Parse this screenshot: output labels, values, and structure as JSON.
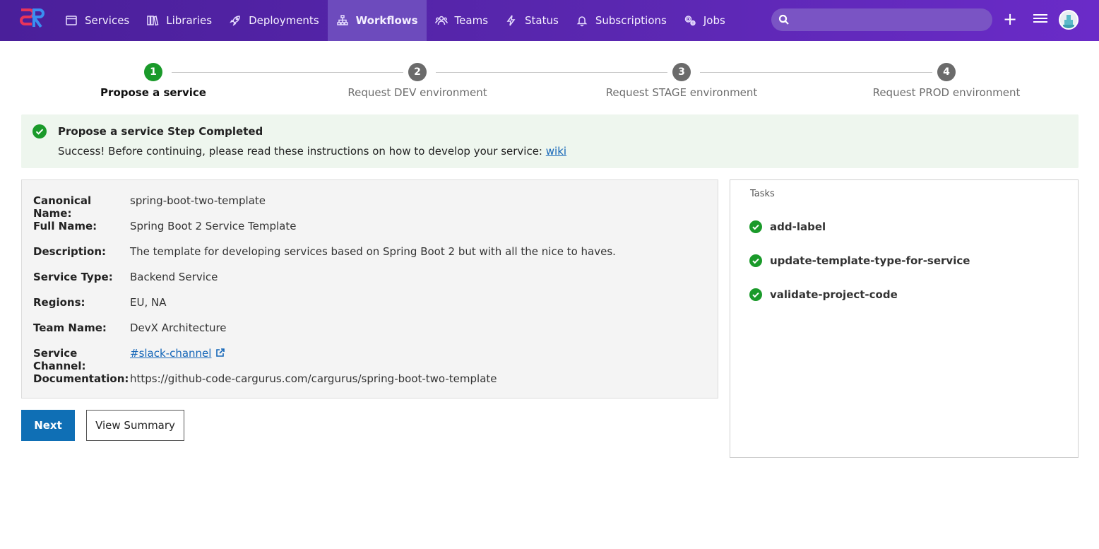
{
  "nav": {
    "items": [
      {
        "label": "Services",
        "icon": "window-icon"
      },
      {
        "label": "Libraries",
        "icon": "books-icon"
      },
      {
        "label": "Deployments",
        "icon": "rocket-icon"
      },
      {
        "label": "Workflows",
        "icon": "sitemap-icon",
        "active": true
      },
      {
        "label": "Teams",
        "icon": "users-icon"
      },
      {
        "label": "Status",
        "icon": "bolt-icon"
      },
      {
        "label": "Subscriptions",
        "icon": "bell-icon"
      },
      {
        "label": "Jobs",
        "icon": "gears-icon"
      }
    ],
    "search_placeholder": "",
    "plus": "+",
    "accent": "#5a27b0"
  },
  "stepper": {
    "steps": [
      {
        "number": "1",
        "label": "Propose a service",
        "status": "completed"
      },
      {
        "number": "2",
        "label": "Request DEV environment",
        "status": "pending"
      },
      {
        "number": "3",
        "label": "Request STAGE environment",
        "status": "pending"
      },
      {
        "number": "4",
        "label": "Request PROD environment",
        "status": "pending"
      }
    ]
  },
  "alert": {
    "title": "Propose a service Step Completed",
    "message": "Success! Before continuing, please read these instructions on how to develop your service:",
    "link": "wiki"
  },
  "details": {
    "rows": [
      {
        "key": "Canonical Name:",
        "value": "spring-boot-two-template"
      },
      {
        "key": "Full Name:",
        "value": "Spring Boot 2 Service Template"
      },
      {
        "key": "Description:",
        "value": "The template for developing services based on Spring Boot 2 but with all the nice to haves."
      },
      {
        "key": "Service Type:",
        "value": "Backend Service"
      },
      {
        "key": "Regions:",
        "value": "EU, NA"
      },
      {
        "key": "Team Name:",
        "value": "DevX Architecture"
      },
      {
        "key": "Service Channel:",
        "value": "#slack-channel"
      },
      {
        "key": "Documentation:",
        "value": "https://github-code-cargurus.com/cargurus/spring-boot-two-template"
      }
    ]
  },
  "buttons": {
    "next": "Next",
    "summary": "View Summary"
  },
  "tasks": {
    "title": "Tasks",
    "items": [
      {
        "label": "add-label",
        "status": "done"
      },
      {
        "label": "update-template-type-for-service",
        "status": "done"
      },
      {
        "label": "validate-project-code",
        "status": "done"
      }
    ]
  }
}
